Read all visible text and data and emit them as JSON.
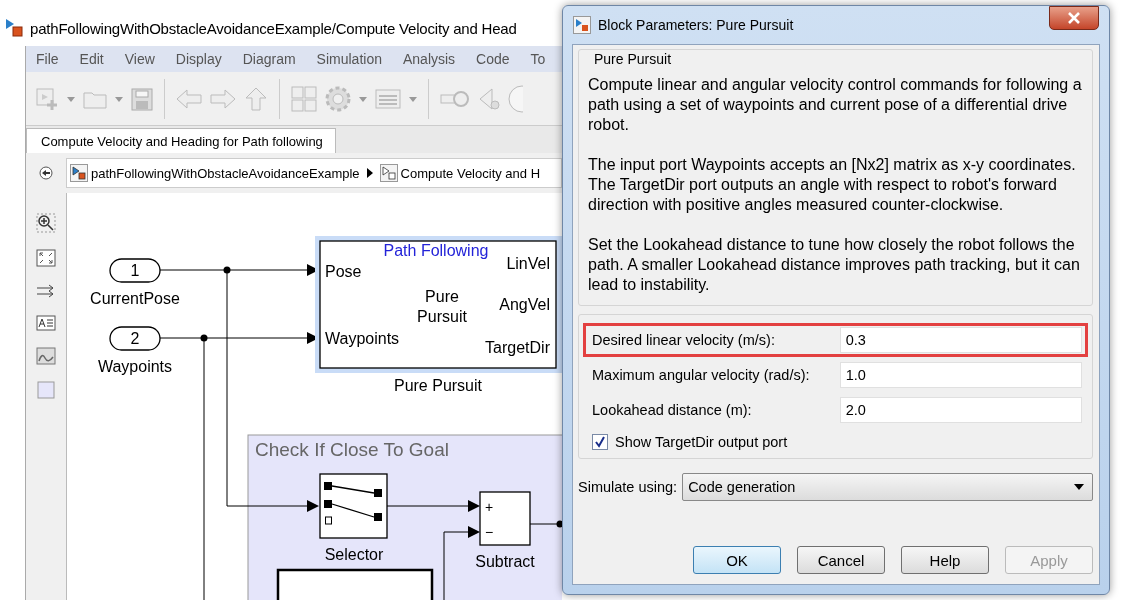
{
  "main_window": {
    "title": "pathFollowingWithObstacleAvoidanceExample/Compute Velocity and Head",
    "menu": [
      "File",
      "Edit",
      "View",
      "Display",
      "Diagram",
      "Simulation",
      "Analysis",
      "Code",
      "To"
    ],
    "tabs": [
      {
        "label": "Compute Velocity and Heading for Path following",
        "selected": true
      }
    ],
    "breadcrumb": [
      "pathFollowingWithObstacleAvoidanceExample",
      "Compute Velocity and H"
    ],
    "diagram": {
      "inports": [
        {
          "number": "1",
          "name": "CurrentPose"
        },
        {
          "number": "2",
          "name": "Waypoints"
        }
      ],
      "block": {
        "annotation": "Path Following",
        "inputs": [
          "Pose",
          "Waypoints"
        ],
        "center_text": [
          "Pure",
          "Pursuit"
        ],
        "outputs": [
          "LinVel",
          "AngVel",
          "TargetDir"
        ],
        "label": "Pure Pursuit",
        "selected": true
      },
      "area": {
        "title": "Check If Close To Goal"
      },
      "selector": {
        "label": "Selector"
      },
      "subtract": {
        "signs": [
          "+",
          "−"
        ],
        "label": "Subtract"
      }
    }
  },
  "dialog": {
    "title": "Block Parameters: Pure Pursuit",
    "group_title": "Pure Pursuit",
    "description": [
      "Compute linear and angular velocity control commands for following a path using a set of waypoints and current pose of a differential drive robot.",
      "The input port Waypoints accepts an [Nx2] matrix as x-y coordinates. The TargetDir port outputs an angle with respect to robot's forward direction with positive angles measured counter-clockwise.",
      "Set the Lookahead distance to tune how closely the robot follows the path. A smaller Lookahead distance improves path tracking, but it can lead to instability."
    ],
    "parameters": [
      {
        "label": "Desired linear velocity (m/s):",
        "value": "0.3",
        "highlighted": true
      },
      {
        "label": "Maximum angular velocity (rad/s):",
        "value": "1.0",
        "highlighted": false
      },
      {
        "label": "Lookahead distance (m):",
        "value": "2.0",
        "highlighted": false
      }
    ],
    "checkbox": {
      "label": "Show TargetDir output port",
      "checked": true
    },
    "simulate": {
      "label": "Simulate using:",
      "value": "Code generation"
    },
    "buttons": [
      {
        "label": "OK",
        "default": true,
        "disabled": false
      },
      {
        "label": "Cancel",
        "default": false,
        "disabled": false
      },
      {
        "label": "Help",
        "default": false,
        "disabled": false
      },
      {
        "label": "Apply",
        "default": false,
        "disabled": true
      }
    ]
  }
}
